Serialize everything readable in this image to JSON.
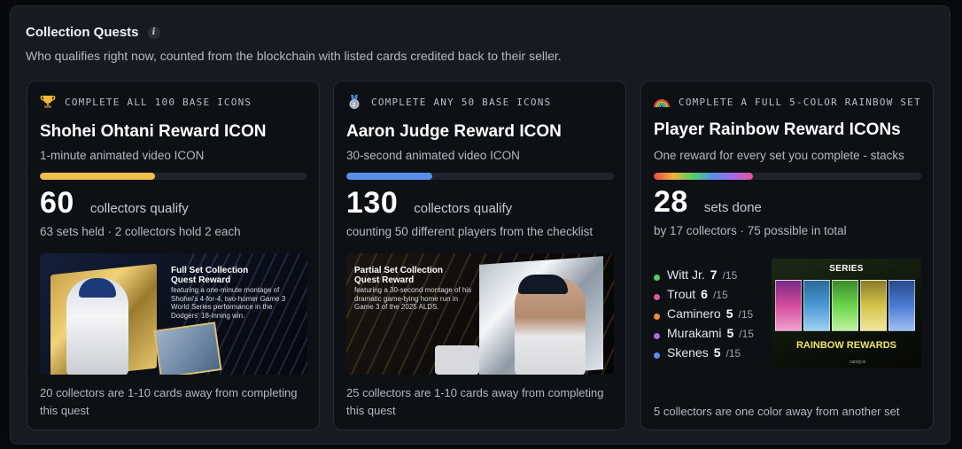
{
  "header": {
    "title": "Collection Quests",
    "info_icon": "info-icon",
    "subtitle": "Who qualifies right now, counted from the blockchain with listed cards credited back to their seller."
  },
  "cards": [
    {
      "icon": "trophy-icon",
      "eyebrow": "COMPLETE ALL 100 BASE ICONS",
      "title": "Shohei Ohtani Reward ICON",
      "subtitle": "1-minute animated video ICON",
      "progress": 0.43,
      "progress_color": "#f0c04a",
      "stat_value": "60",
      "stat_label": "collectors qualify",
      "stat_sub": "63 sets held · 2 collectors hold 2 each",
      "image": {
        "heading_line1": "Full Set Collection",
        "heading_line2": "Quest Reward",
        "body": "featuring a one-minute montage of Shohei's 4-for-4, two-homer Game 3 World Series performance in the Dodgers' 18-inning win."
      },
      "footer": "20 collectors are 1-10 cards away from completing this quest"
    },
    {
      "icon": "medal-icon",
      "eyebrow": "COMPLETE ANY 50 BASE ICONS",
      "title": "Aaron Judge Reward ICON",
      "subtitle": "30-second animated video ICON",
      "progress": 0.32,
      "progress_color": "#5b8dea",
      "stat_value": "130",
      "stat_label": "collectors qualify",
      "stat_sub": "counting 50 different players from the checklist",
      "image": {
        "heading_line1": "Partial Set Collection",
        "heading_line2": "Quest Reward",
        "body": "featuring a 30-second montage of his dramatic game-tying home run in Game 3 of the 2025 ALDS."
      },
      "footer": "25 collectors are 1-10 cards away from completing this quest"
    },
    {
      "icon": "rainbow-icon",
      "eyebrow": "COMPLETE A FULL 5-COLOR RAINBOW SET",
      "title": "Player Rainbow Reward ICONs",
      "subtitle": "One reward for every set you complete - stacks",
      "progress": 0.37,
      "stat_value": "28",
      "stat_label": "sets done",
      "stat_sub": "by 17 collectors · 75 possible in total",
      "players": [
        {
          "name": "Witt Jr.",
          "count": "7",
          "total": "/15",
          "color": "#4fcf6a"
        },
        {
          "name": "Trout",
          "count": "6",
          "total": "/15",
          "color": "#e0569a"
        },
        {
          "name": "Caminero",
          "count": "5",
          "total": "/15",
          "color": "#ee8a3c"
        },
        {
          "name": "Murakami",
          "count": "5",
          "total": "/15",
          "color": "#a86ae6"
        },
        {
          "name": "Skenes",
          "count": "5",
          "total": "/15",
          "color": "#5b8dea"
        }
      ],
      "image": {
        "series": "SERIES",
        "headline": "RAINBOW REWARDS",
        "small_text": "candy.io"
      },
      "footer": "5 collectors are one color away from another set"
    }
  ]
}
